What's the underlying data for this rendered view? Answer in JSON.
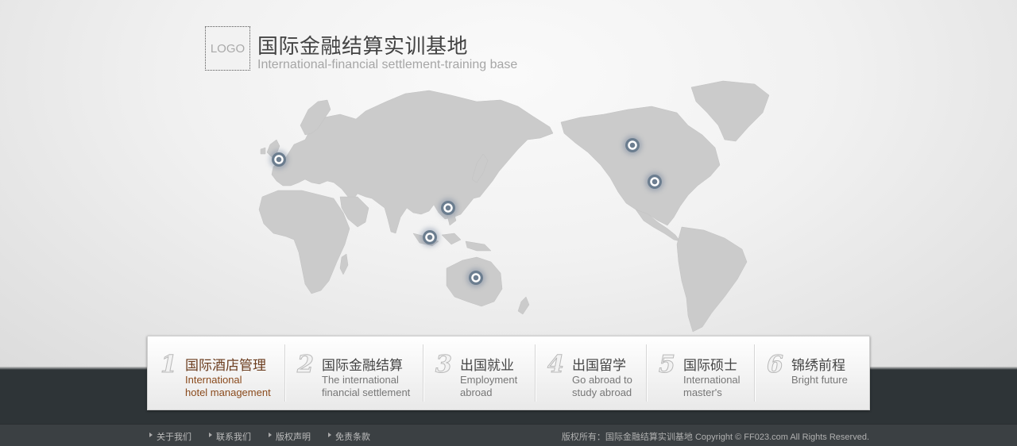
{
  "header": {
    "logo_text": "LOGO",
    "title": "国际金融结算实训基地",
    "subtitle": "International-financial settlement-training base"
  },
  "map": {
    "land_color": "#cbcbcb",
    "pin_color": "#6b7d8f"
  },
  "menu": {
    "items": [
      {
        "num": "1",
        "title": "国际酒店管理",
        "en1": "International",
        "en2": "hotel management",
        "active": true
      },
      {
        "num": "2",
        "title": "国际金融结算",
        "en1": "The international",
        "en2": "financial settlement",
        "active": false
      },
      {
        "num": "3",
        "title": "出国就业",
        "en1": "Employment",
        "en2": "abroad",
        "active": false
      },
      {
        "num": "4",
        "title": "出国留学",
        "en1": "Go abroad to",
        "en2": "study abroad",
        "active": false
      },
      {
        "num": "5",
        "title": "国际硕士",
        "en1": "International",
        "en2": "master's",
        "active": false
      },
      {
        "num": "6",
        "title": "锦绣前程",
        "en1": "Bright future",
        "en2": "",
        "active": false
      }
    ],
    "active_color": "#6b3c1e"
  },
  "footer": {
    "links": [
      "关于我们",
      "联系我们",
      "版权声明",
      "免责条款"
    ],
    "copyright": "版权所有：国际金融结算实训基地 Copyright © FF023.com All Rights Reserved."
  }
}
